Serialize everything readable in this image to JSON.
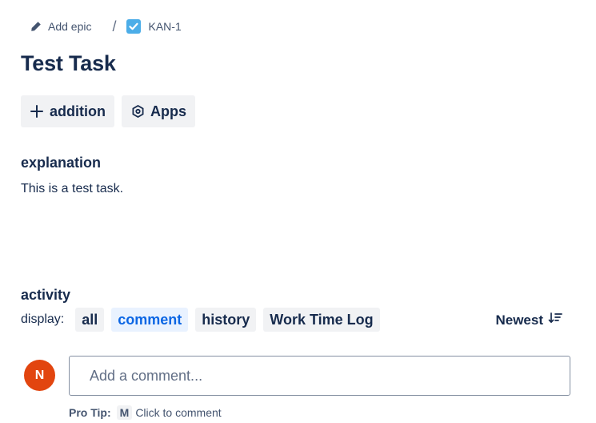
{
  "breadcrumb": {
    "add_epic": "Add epic",
    "separator": "/",
    "issue_key": "KAN-1"
  },
  "issue": {
    "title": "Test Task"
  },
  "actions": {
    "add_label": "addition",
    "apps_label": "Apps"
  },
  "description": {
    "heading": "explanation",
    "text": "This is a test task."
  },
  "activity": {
    "heading": "activity",
    "display_label": "display:",
    "filters": [
      "all",
      "comment",
      "history",
      "Work Time Log"
    ],
    "active_filter": "comment",
    "sort_label": "Newest"
  },
  "comment": {
    "avatar_initial": "N",
    "placeholder": "Add a comment...",
    "protip_label": "Pro Tip:",
    "protip_key": "M",
    "protip_text": "Click to comment"
  },
  "colors": {
    "accent": "#0c66e4",
    "avatar": "#e2450f",
    "checkbox": "#4bade8"
  },
  "icons": {
    "add_epic": "pencil-icon",
    "issue_type": "task-checkbox-icon",
    "add": "plus-icon",
    "apps": "hexagon-icon",
    "sort": "sort-descending-icon"
  }
}
